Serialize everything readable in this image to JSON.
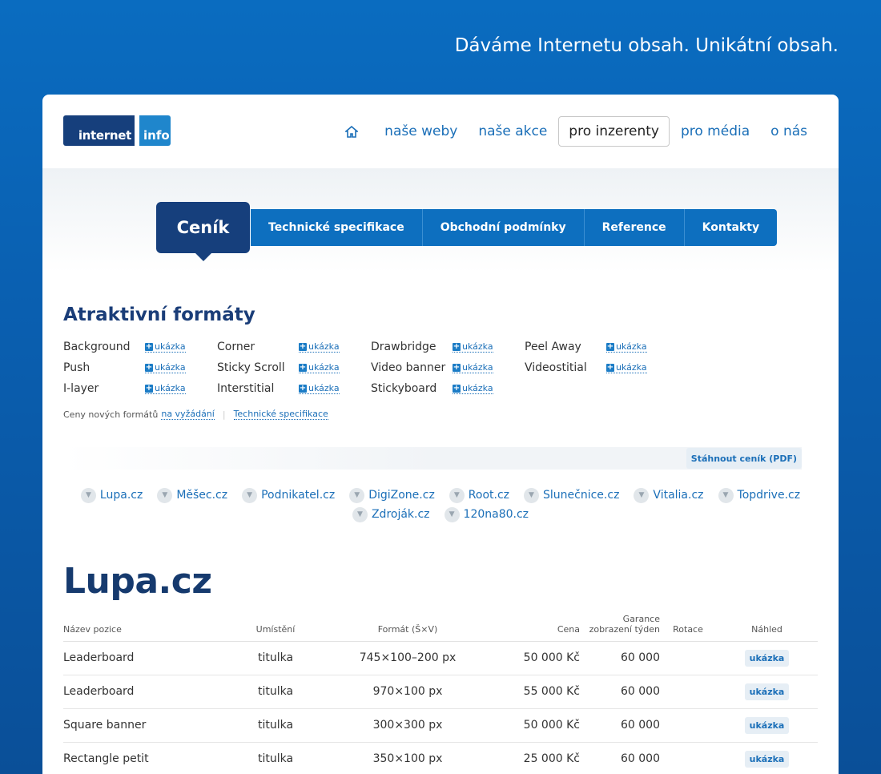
{
  "tagline": "Dáváme Internetu obsah. Unikátní obsah.",
  "logo": {
    "part1": "internet",
    "part2": "info"
  },
  "topnav": {
    "items": [
      "naše weby",
      "naše akce",
      "pro inzerenty",
      "pro média",
      "o nás"
    ]
  },
  "subnav": {
    "current": "Ceník",
    "tabs": [
      "Technické specifikace",
      "Obchodní podmínky",
      "Reference",
      "Kontakty"
    ]
  },
  "formats": {
    "title": "Atraktivní formáty",
    "show_label": "ukázka",
    "rows": [
      [
        "Background",
        "Corner",
        "Drawbridge",
        "Peel Away"
      ],
      [
        "Push",
        "Sticky Scroll",
        "Video banner",
        "Videostitial"
      ],
      [
        "I-layer",
        "Interstitial",
        "Stickyboard"
      ]
    ],
    "note_prefix": "Ceny nových formátů",
    "note_link": "na vyžádání",
    "note_link2": "Technické specifikace"
  },
  "download_label": "Stáhnout ceník (PDF)",
  "sites": {
    "row1": [
      "Lupa.cz",
      "Měšec.cz",
      "Podnikatel.cz",
      "DigiZone.cz",
      "Root.cz",
      "Slunečnice.cz",
      "Vitalia.cz",
      "Topdrive.cz"
    ],
    "row2": [
      "Zdroják.cz",
      "120na80.cz"
    ]
  },
  "site_title": "Lupa.cz",
  "table": {
    "headers": [
      "Název pozice",
      "Umístění",
      "Formát (Š×V)",
      "Cena",
      "Garance zobrazení týden",
      "Rotace",
      "Náhled"
    ],
    "rows": [
      [
        "Leaderboard",
        "titulka",
        "745×100–200 px",
        "50 000 Kč",
        "60 000",
        "",
        "ukázka"
      ],
      [
        "Leaderboard",
        "titulka",
        "970×100 px",
        "55 000 Kč",
        "60 000",
        "",
        "ukázka"
      ],
      [
        "Square banner",
        "titulka",
        "300×300 px",
        "50 000 Kč",
        "60 000",
        "",
        "ukázka"
      ],
      [
        "Rectangle petit",
        "titulka",
        "350×100 px",
        "25 000 Kč",
        "60 000",
        "",
        "ukázka"
      ]
    ]
  }
}
